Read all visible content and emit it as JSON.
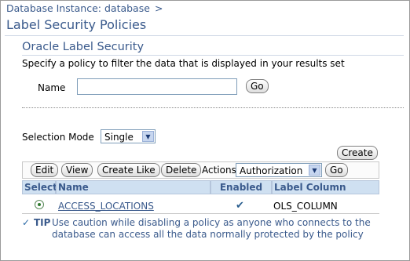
{
  "breadcrumb": {
    "label": "Database Instance: database",
    "separator": ">"
  },
  "page_title": "Label Security Policies",
  "section_title": "Oracle Label Security",
  "description": "Specify a policy to filter the data that is displayed in your results set",
  "filter": {
    "name_label": "Name",
    "name_value": "",
    "go_label": "Go"
  },
  "selection_mode": {
    "label": "Selection Mode",
    "value": "Single"
  },
  "create_label": "Create",
  "toolbar": {
    "edit": "Edit",
    "view": "View",
    "create_like": "Create Like",
    "delete": "Delete",
    "actions_label": "Actions",
    "actions_value": "Authorization",
    "go": "Go"
  },
  "table": {
    "headers": {
      "select": "Select",
      "name": "Name",
      "enabled": "Enabled",
      "label_column": "Label Column"
    },
    "rows": [
      {
        "selected": true,
        "name": "ACCESS_LOCATIONS",
        "enabled_mark": "✔",
        "label_column": "OLS_COLUMN"
      }
    ]
  },
  "tip": {
    "label": "TIP",
    "text": "Use caution while disabling a policy as anyone who connects to the database can access all the data normally protected by the policy"
  }
}
